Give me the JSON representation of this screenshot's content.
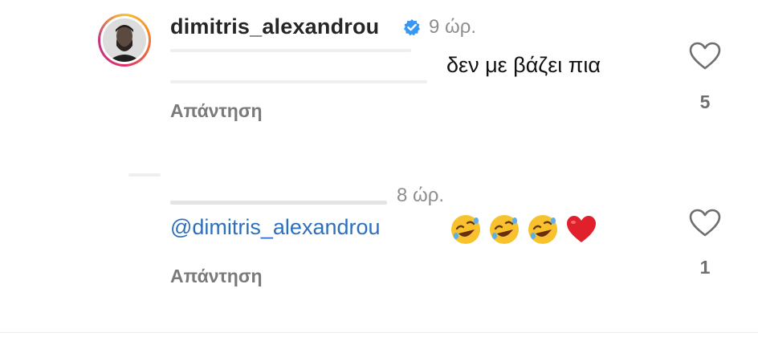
{
  "comments": [
    {
      "username": "dimitris_alexandrou",
      "verified": true,
      "time": "9 ώρ.",
      "text": "δεν με βάζει πια",
      "reply_label": "Απάντηση",
      "likes": "5",
      "avatar_icon": "profile-photo-avatar",
      "like_icon": "heart-outline-icon"
    },
    {
      "username": "",
      "time": "8 ώρ.",
      "mention": "@dimitris_alexandrou",
      "emojis": [
        "rolling-on-floor-laughing-emoji",
        "rolling-on-floor-laughing-emoji",
        "rolling-on-floor-laughing-emoji",
        "red-heart-emoji"
      ],
      "reply_label": "Απάντηση",
      "likes": "1",
      "like_icon": "heart-outline-icon"
    }
  ],
  "colors": {
    "username": "#262626",
    "meta": "#8e8e8e",
    "mention": "#2e6fbd",
    "verified": "#3897f0",
    "heart": "#e0202b"
  }
}
